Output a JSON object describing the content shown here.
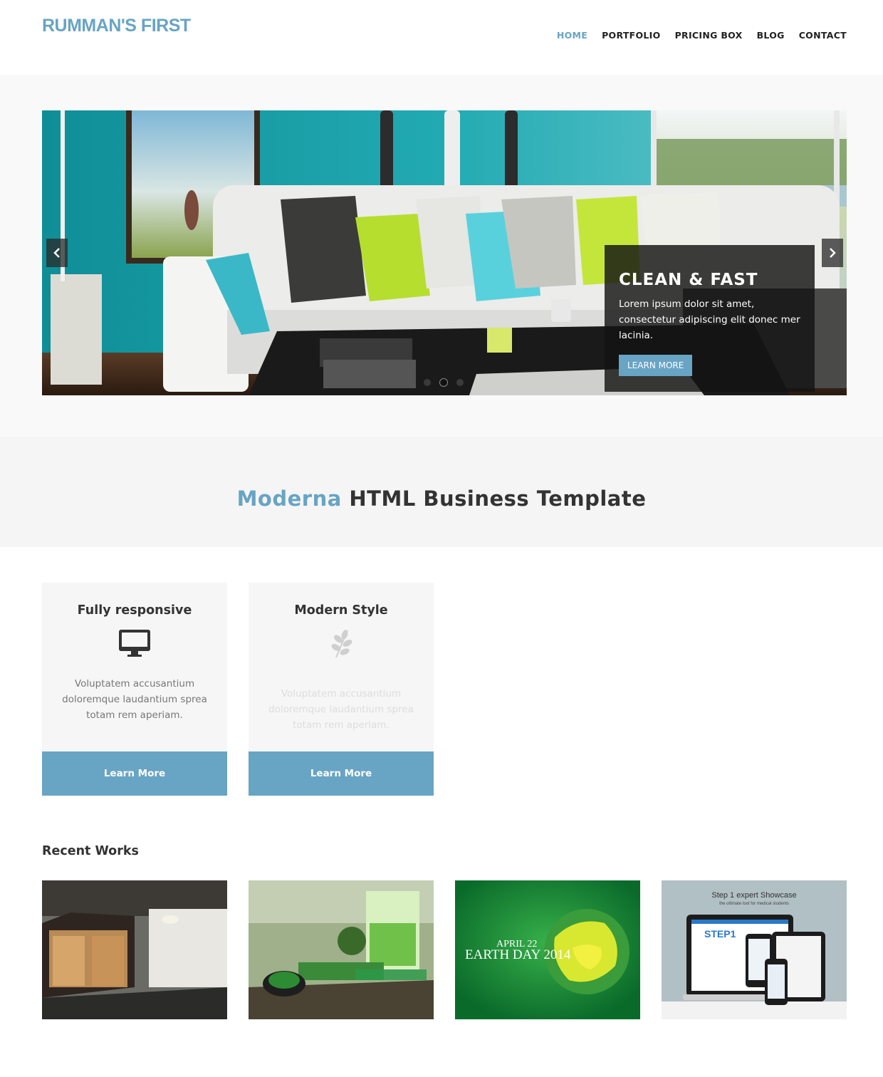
{
  "header": {
    "logo": "RUMMAN'S FIRST",
    "nav": [
      "HOME",
      "PORTFOLIO",
      "PRICING BOX",
      "BLOG",
      "CONTACT"
    ]
  },
  "slider": {
    "caption_title": "CLEAN & FAST",
    "caption_text": "Lorem ipsum dolor sit amet, consectetur adipiscing elit donec mer lacinia.",
    "button_label": "LEARN MORE",
    "slide_count": 3,
    "active_slide": 2
  },
  "headline": {
    "accent": "Moderna",
    "rest": " HTML Business Template"
  },
  "features": [
    {
      "title": "Fully responsive",
      "icon": "desktop-icon",
      "text": "Voluptatem accusantium doloremque laudantium sprea totam rem aperiam.",
      "button": "Learn More"
    },
    {
      "title": "Modern Style",
      "icon": "leaf-icon",
      "text": "Voluptatem accusantium doloremque laudantium sprea totam rem aperiam.",
      "button": "Learn More"
    }
  ],
  "recent_works": {
    "title": "Recent Works",
    "earth_day": {
      "date": "APRIL 22",
      "label": "EARTH DAY 2014"
    },
    "showcase": {
      "title_bold": "Step 1 expert",
      "title_rest": " Showcase",
      "subtitle": "the ultimate tool for medical students",
      "logo": "STEP1"
    }
  },
  "colors": {
    "accent": "#68a4c4",
    "dark": "#333333",
    "band": "#f5f5f5"
  }
}
